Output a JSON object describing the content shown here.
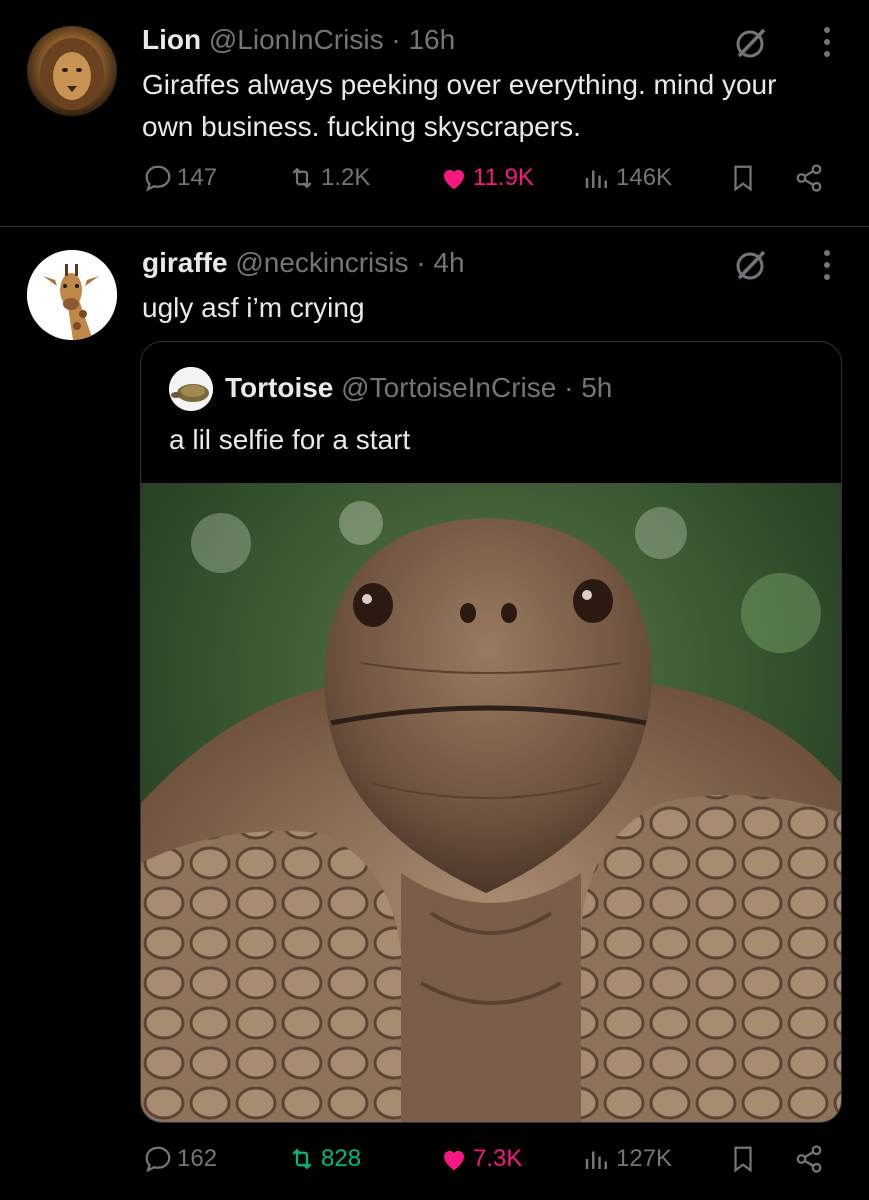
{
  "tweets": [
    {
      "name": "Lion",
      "handle": "@LionInCrisis",
      "time": "· 16h",
      "text": "Giraffes always peeking over everything. mind your own business. fucking skyscrapers.",
      "stats": {
        "replies": "147",
        "reposts": "1.2K",
        "likes": "11.9K",
        "views": "146K"
      }
    },
    {
      "name": "giraffe",
      "handle": "@neckincrisis",
      "time": "· 4h",
      "text": "ugly asf i’m crying",
      "quote": {
        "name": "Tortoise",
        "handle": "@TortoiseInCrise",
        "time": "· 5h",
        "text": "a lil selfie for a start"
      },
      "stats": {
        "replies": "162",
        "reposts": "828",
        "likes": "7.3K",
        "views": "127K"
      }
    }
  ],
  "icons": {
    "reply": "reply-icon",
    "repost": "repost-icon",
    "like": "heart-icon",
    "views": "views-icon",
    "bookmark": "bookmark-icon",
    "share": "share-icon",
    "grok": "grok-icon",
    "more": "more-icon"
  },
  "colors": {
    "background": "#000000",
    "text": "#e7e9ea",
    "muted": "#71767b",
    "like": "#f91880",
    "repost": "#00ba7c",
    "divider": "#2f3336"
  }
}
